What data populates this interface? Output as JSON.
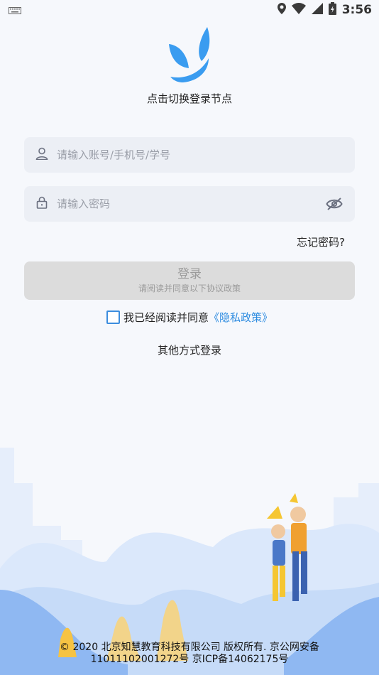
{
  "status_bar": {
    "time": "3:56",
    "icons": [
      "keyboard-icon",
      "location-icon",
      "wifi-icon",
      "signal-icon",
      "battery-icon"
    ]
  },
  "header": {
    "node_switch_label": "点击切换登录节点"
  },
  "form": {
    "account_placeholder": "请输入账号/手机号/学号",
    "password_placeholder": "请输入密码",
    "forgot_label": "忘记密码?"
  },
  "login_button": {
    "title": "登录",
    "subtitle": "请阅读并同意以下协议政策"
  },
  "agreement": {
    "text": "我已经阅读并同意",
    "link": "《隐私政策》"
  },
  "other_login_label": "其他方式登录",
  "footer": {
    "line1": "© 2020 北京知慧教育科技有限公司 版权所有. 京公网安备",
    "line2": "11011102001272号 京ICP备14062175号"
  },
  "colors": {
    "accent": "#2c8be0",
    "logo": "#3a9cf0",
    "disabled_button": "#dcdcdc"
  }
}
